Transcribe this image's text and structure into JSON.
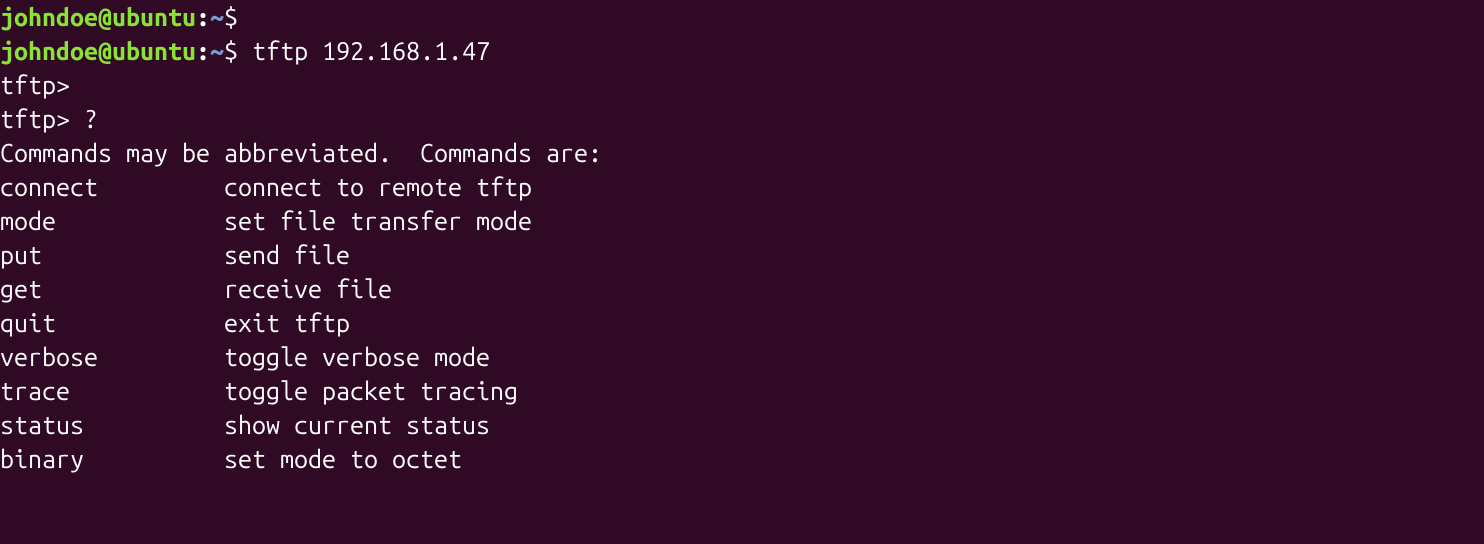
{
  "prompt": {
    "user_host": "johndoe@ubuntu",
    "colon": ":",
    "tilde": "~",
    "dollar": "$"
  },
  "lines": {
    "l1_cmd": " ",
    "l2_cmd": " tftp 192.168.1.47",
    "l3": "tftp> ",
    "l4": "tftp> ?",
    "l5": "Commands may be abbreviated.  Commands are:",
    "l6": "",
    "l7": "connect         connect to remote tftp",
    "l8": "mode            set file transfer mode",
    "l9": "put             send file",
    "l10": "get             receive file",
    "l11": "quit            exit tftp",
    "l12": "verbose         toggle verbose mode",
    "l13": "trace           toggle packet tracing",
    "l14": "status          show current status",
    "l15": "binary          set mode to octet"
  }
}
